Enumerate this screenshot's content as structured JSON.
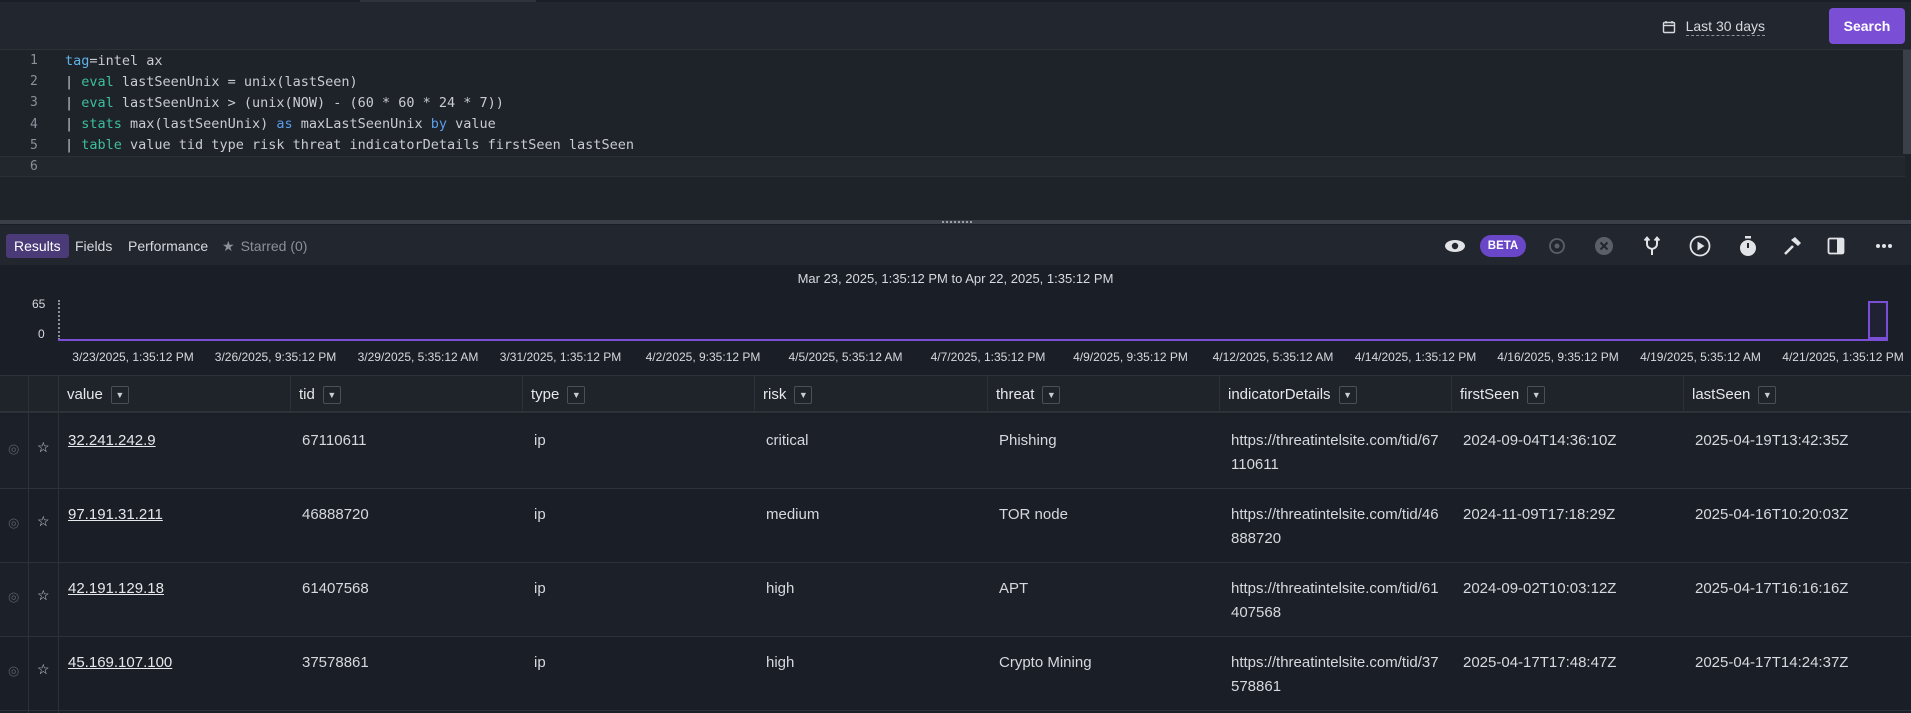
{
  "topbar": {
    "time_range": "Last 30 days",
    "search_label": "Search"
  },
  "editor": {
    "lines": [
      {
        "num": "1",
        "parts": [
          [
            "tag",
            "kw-tag"
          ],
          [
            "=intel ax",
            ""
          ]
        ]
      },
      {
        "num": "2",
        "parts": [
          [
            "| ",
            ""
          ],
          [
            "eval",
            "kw-cmd"
          ],
          [
            " lastSeenUnix = unix(lastSeen)",
            ""
          ]
        ]
      },
      {
        "num": "3",
        "parts": [
          [
            "| ",
            ""
          ],
          [
            "eval",
            "kw-cmd"
          ],
          [
            " lastSeenUnix > (unix(NOW) - (60 * 60 * 24 * 7))",
            ""
          ]
        ]
      },
      {
        "num": "4",
        "parts": [
          [
            "| ",
            ""
          ],
          [
            "stats",
            "kw-cmd"
          ],
          [
            " max(lastSeenUnix) ",
            ""
          ],
          [
            "as",
            "kw-by"
          ],
          [
            " maxLastSeenUnix ",
            ""
          ],
          [
            "by",
            "kw-by"
          ],
          [
            " value",
            ""
          ]
        ]
      },
      {
        "num": "5",
        "parts": [
          [
            "| ",
            ""
          ],
          [
            "table",
            "kw-cmd"
          ],
          [
            " value tid type risk threat indicatorDetails firstSeen lastSeen",
            ""
          ]
        ]
      },
      {
        "num": "6",
        "parts": []
      }
    ]
  },
  "results_bar": {
    "tabs": [
      "Results",
      "Fields",
      "Performance"
    ],
    "starred": "Starred (0)",
    "beta": "BETA"
  },
  "timeline": {
    "range": "Mar 23, 2025, 1:35:12 PM to Apr 22, 2025, 1:35:12 PM",
    "y_max": "65",
    "y_min": "0",
    "ticks": [
      "3/23/2025, 1:35:12 PM",
      "3/26/2025, 9:35:12 PM",
      "3/29/2025, 5:35:12 AM",
      "3/31/2025, 1:35:12 PM",
      "4/2/2025, 9:35:12 PM",
      "4/5/2025, 5:35:12 AM",
      "4/7/2025, 1:35:12 PM",
      "4/9/2025, 9:35:12 PM",
      "4/12/2025, 5:35:12 AM",
      "4/14/2025, 1:35:12 PM",
      "4/16/2025, 9:35:12 PM",
      "4/19/2025, 5:35:12 AM",
      "4/21/2025, 1:35:12 PM"
    ]
  },
  "table": {
    "columns": [
      "value",
      "tid",
      "type",
      "risk",
      "threat",
      "indicatorDetails",
      "firstSeen",
      "lastSeen"
    ],
    "rows": [
      [
        "32.241.242.9",
        "67110611",
        "ip",
        "critical",
        "Phishing",
        "https://threatintelsite.com/tid/67110611",
        "2024-09-04T14:36:10Z",
        "2025-04-19T13:42:35Z"
      ],
      [
        "97.191.31.211",
        "46888720",
        "ip",
        "medium",
        "TOR node",
        "https://threatintelsite.com/tid/46888720",
        "2024-11-09T17:18:29Z",
        "2025-04-16T10:20:03Z"
      ],
      [
        "42.191.129.18",
        "61407568",
        "ip",
        "high",
        "APT",
        "https://threatintelsite.com/tid/61407568",
        "2024-09-02T10:03:12Z",
        "2025-04-17T16:16:16Z"
      ],
      [
        "45.169.107.100",
        "37578861",
        "ip",
        "high",
        "Crypto Mining",
        "https://threatintelsite.com/tid/37578861",
        "2025-04-17T17:48:47Z",
        "2025-04-17T14:24:37Z"
      ]
    ]
  }
}
